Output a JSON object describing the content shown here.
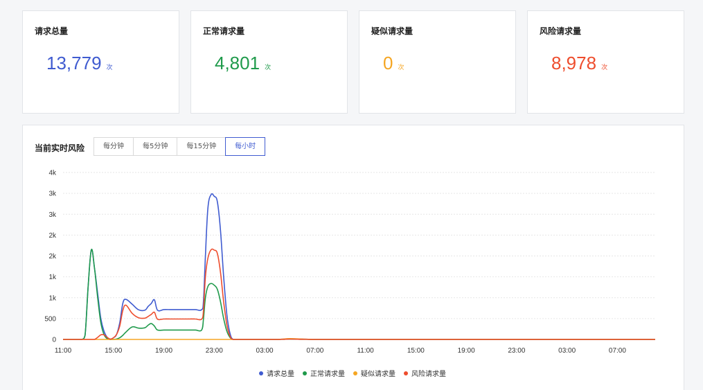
{
  "colors": {
    "total": "#3f5bd0",
    "normal": "#1f9a4b",
    "suspicious": "#f5a623",
    "risk": "#ee4d2d"
  },
  "cards": [
    {
      "title": "请求总量",
      "value": "13,779",
      "unit": "次",
      "color": "#3f5bd0"
    },
    {
      "title": "正常请求量",
      "value": "4,801",
      "unit": "次",
      "color": "#1f9a4b"
    },
    {
      "title": "疑似请求量",
      "value": "0",
      "unit": "次",
      "color": "#f5a623"
    },
    {
      "title": "风险请求量",
      "value": "8,978",
      "unit": "次",
      "color": "#ee4d2d"
    }
  ],
  "panel": {
    "title": "当前实时风险",
    "tabs": [
      "每分钟",
      "每5分钟",
      "每15分钟",
      "每小时"
    ],
    "active_tab": "每小时"
  },
  "chart_data": {
    "type": "line",
    "x_tick_labels": [
      "11:00",
      "15:00",
      "19:00",
      "23:00",
      "03:00",
      "07:00",
      "11:00",
      "15:00",
      "19:00",
      "23:00",
      "03:00",
      "07:00"
    ],
    "y_tick_labels": [
      "0",
      "500",
      "1k",
      "1k",
      "2k",
      "2k",
      "3k",
      "3k",
      "4k"
    ],
    "ylim": [
      0,
      4000
    ],
    "x_hours": [
      0,
      1,
      2,
      3,
      3.5,
      4,
      4.5,
      5,
      5.5,
      6,
      6.5,
      7,
      7.5,
      8,
      8.5,
      9,
      9.5,
      10,
      11,
      12,
      13,
      13.5,
      14,
      14.5,
      15,
      16,
      17,
      18,
      19,
      20,
      21,
      22,
      22.3,
      22.6,
      23,
      23.5,
      24,
      24.5,
      25,
      25.5,
      26,
      26.5,
      27,
      28,
      30,
      32,
      34,
      35,
      36,
      38,
      40,
      44,
      48,
      52,
      56,
      60,
      64,
      68,
      72,
      76,
      80,
      84,
      88,
      92,
      94
    ],
    "series": [
      {
        "name": "请求总量",
        "color": "#3f5bd0",
        "values": [
          0,
          0,
          0,
          0,
          100,
          1300,
          2150,
          1700,
          1100,
          500,
          200,
          50,
          0,
          40,
          120,
          400,
          870,
          960,
          840,
          710,
          700,
          790,
          860,
          950,
          700,
          715,
          715,
          715,
          715,
          715,
          715,
          712,
          930,
          2000,
          3150,
          3470,
          3430,
          3300,
          2600,
          1500,
          600,
          150,
          0,
          0,
          0,
          0,
          0,
          8,
          15,
          8,
          0,
          0,
          0,
          0,
          0,
          0,
          0,
          0,
          0,
          0,
          0,
          0,
          0,
          0,
          0
        ]
      },
      {
        "name": "正常请求量",
        "color": "#1f9a4b",
        "values": [
          0,
          0,
          0,
          0,
          100,
          1300,
          2150,
          1700,
          1000,
          400,
          120,
          20,
          0,
          0,
          10,
          40,
          100,
          180,
          300,
          270,
          280,
          340,
          380,
          320,
          225,
          225,
          225,
          225,
          225,
          225,
          225,
          225,
          500,
          1000,
          1270,
          1340,
          1300,
          1200,
          900,
          500,
          200,
          50,
          0,
          0,
          0,
          0,
          0,
          4,
          8,
          4,
          0,
          0,
          0,
          0,
          0,
          0,
          0,
          0,
          0,
          0,
          0,
          0,
          0,
          0,
          0
        ]
      },
      {
        "name": "疑似请求量",
        "color": "#f5a623",
        "values": [
          0,
          0,
          0,
          0,
          0,
          0,
          0,
          0,
          0,
          0,
          0,
          0,
          0,
          0,
          0,
          0,
          0,
          0,
          0,
          0,
          0,
          0,
          0,
          0,
          0,
          0,
          0,
          0,
          0,
          0,
          0,
          0,
          0,
          0,
          0,
          0,
          0,
          0,
          0,
          0,
          0,
          0,
          0,
          0,
          0,
          0,
          0,
          10,
          20,
          10,
          0,
          0,
          0,
          0,
          0,
          0,
          0,
          0,
          0,
          0,
          0,
          0,
          0,
          0,
          0
        ]
      },
      {
        "name": "风险请求量",
        "color": "#ee4d2d",
        "values": [
          0,
          0,
          0,
          0,
          0,
          0,
          0,
          0,
          50,
          110,
          110,
          50,
          10,
          40,
          120,
          320,
          700,
          820,
          620,
          520,
          510,
          550,
          600,
          650,
          485,
          490,
          490,
          490,
          490,
          490,
          490,
          487,
          700,
          1500,
          1950,
          2150,
          2140,
          2060,
          1600,
          900,
          350,
          80,
          0,
          0,
          0,
          0,
          0,
          4,
          8,
          4,
          0,
          0,
          0,
          0,
          0,
          0,
          0,
          0,
          0,
          0,
          0,
          0,
          0,
          0,
          0
        ]
      }
    ],
    "legend_position": "bottom",
    "grid": true
  }
}
